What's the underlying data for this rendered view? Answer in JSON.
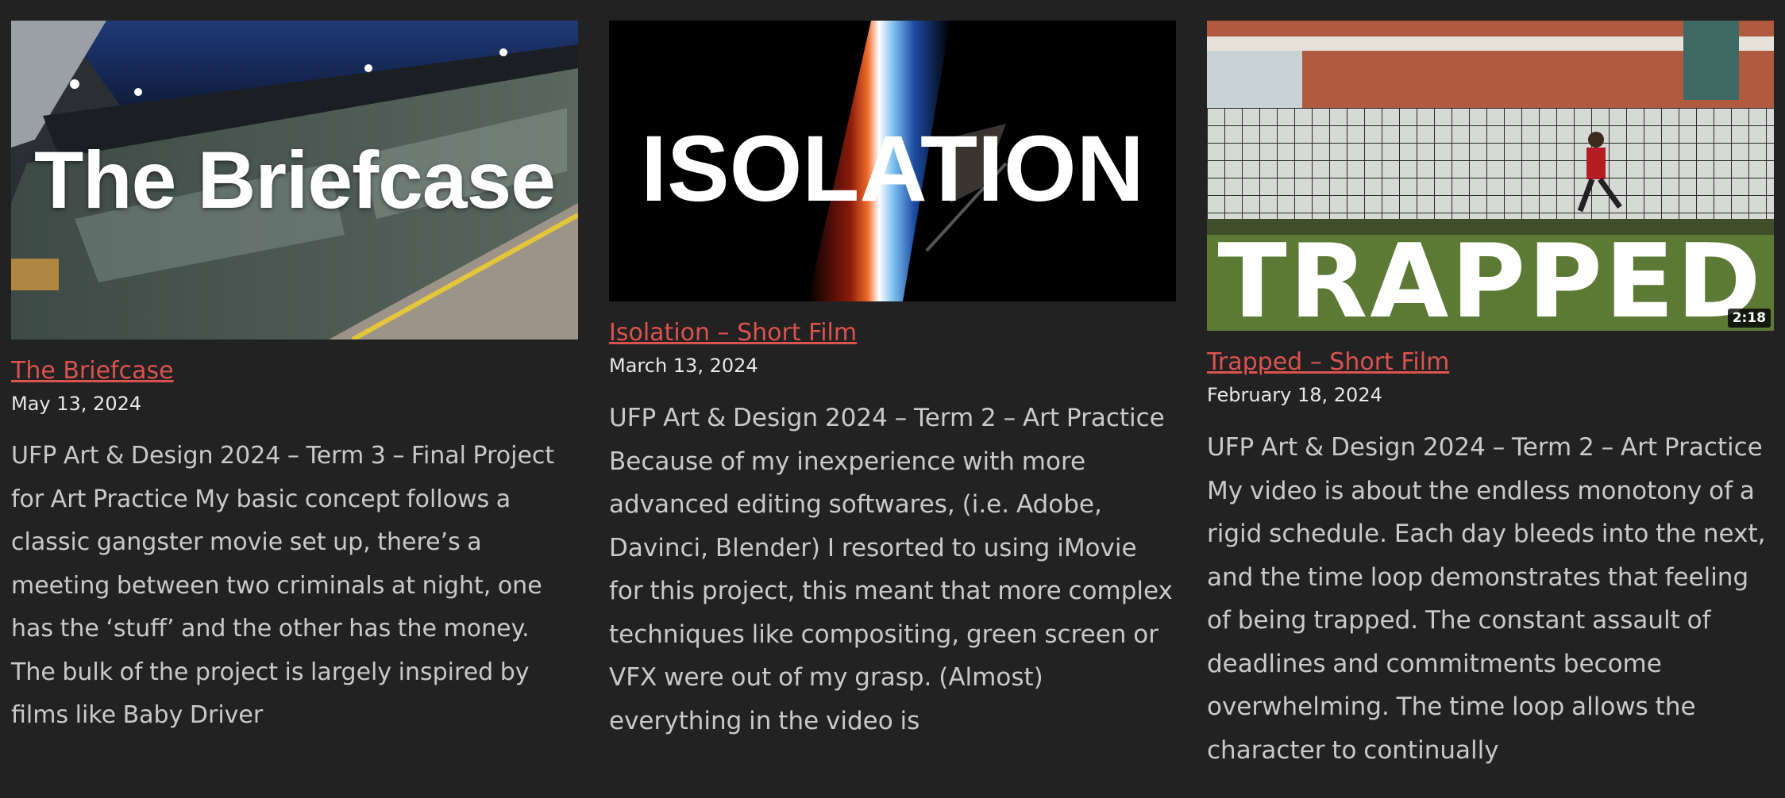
{
  "posts": [
    {
      "thumb_text": "The Briefcase",
      "title": "The Briefcase",
      "date": "May 13, 2024",
      "excerpt": "UFP Art & Design 2024 – Term 3 – Final Project for Art Practice My basic concept follows a classic gangster movie set up, there’s a meeting between two criminals at night, one has the ‘stuff’ and the other has the money. The bulk of the project is largely inspired by films like Baby Driver"
    },
    {
      "thumb_text": "ISOLATION",
      "title": "Isolation – Short Film",
      "date": "March 13, 2024",
      "excerpt": "UFP Art & Design 2024 – Term 2 – Art Practice Because of my inexperience with more advanced editing softwares, (i.e. Adobe, Davinci, Blender) I resorted to using iMovie for this project, this meant that more complex techniques like compositing, green screen or VFX were out of my grasp. (Almost) everything in the video is"
    },
    {
      "thumb_text": "TRAPPED",
      "duration": "2:18",
      "title": "Trapped – Short Film",
      "date": "February 18, 2024",
      "excerpt": "UFP Art & Design 2024 – Term 2 – Art Practice My video is about the endless monotony of a rigid schedule.  Each day bleeds into the next, and the time loop demonstrates that feeling of being trapped. The constant assault of deadlines and commitments become overwhelming. The time loop allows the character to continually"
    }
  ]
}
